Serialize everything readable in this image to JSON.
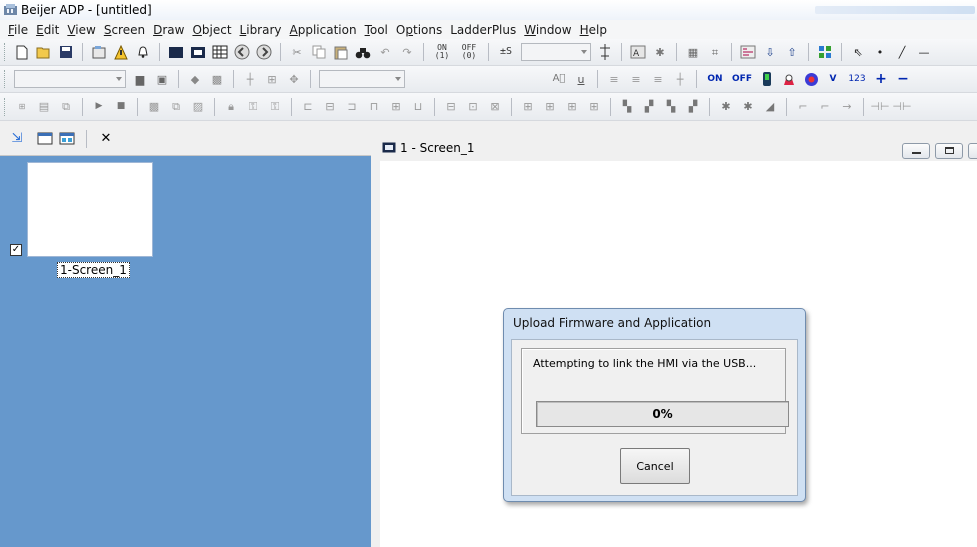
{
  "window": {
    "title": "Beijer ADP - [untitled]"
  },
  "menu": [
    {
      "label": "File",
      "u": "F",
      "rest": "ile"
    },
    {
      "label": "Edit",
      "u": "E",
      "rest": "dit"
    },
    {
      "label": "View",
      "u": "V",
      "rest": "iew"
    },
    {
      "label": "Screen",
      "u": "S",
      "rest": "creen"
    },
    {
      "label": "Draw",
      "u": "D",
      "rest": "raw"
    },
    {
      "label": "Object",
      "u": "O",
      "rest": "bject"
    },
    {
      "label": "Library",
      "u": "L",
      "rest": "ibrary"
    },
    {
      "label": "Application",
      "u": "A",
      "rest": "pplication"
    },
    {
      "label": "Tool",
      "u": "T",
      "rest": "ool"
    },
    {
      "label": "Options",
      "pre": "O",
      "u": "p",
      "rest": "tions"
    },
    {
      "label": "LadderPlus",
      "u": "",
      "rest": "LadderPlus"
    },
    {
      "label": "Window",
      "u": "W",
      "rest": "indow"
    },
    {
      "label": "Help",
      "u": "H",
      "rest": "elp"
    }
  ],
  "toolbar1": {
    "on_label": "ON",
    "on_sub": "(1)",
    "off_label": "OFF",
    "off_sub": "(0)",
    "s_label": "±S"
  },
  "toolbar2": {
    "text_on": "ON",
    "text_off": "OFF",
    "text_v": "V",
    "text_123": "123"
  },
  "left_pane": {
    "screen_item": {
      "label": "1-Screen_1",
      "checked": true
    }
  },
  "document": {
    "title": "1 - Screen_1"
  },
  "dialog": {
    "title": "Upload Firmware and Application",
    "status": "Attempting to link the HMI via the USB...",
    "progress_text": "0%",
    "progress_value": 0,
    "cancel_label": "Cancel"
  },
  "colors": {
    "left_pane_bg": "#6698cc",
    "dialog_frame": "#cfe0f3",
    "canvas_bg": "#ffffff"
  }
}
